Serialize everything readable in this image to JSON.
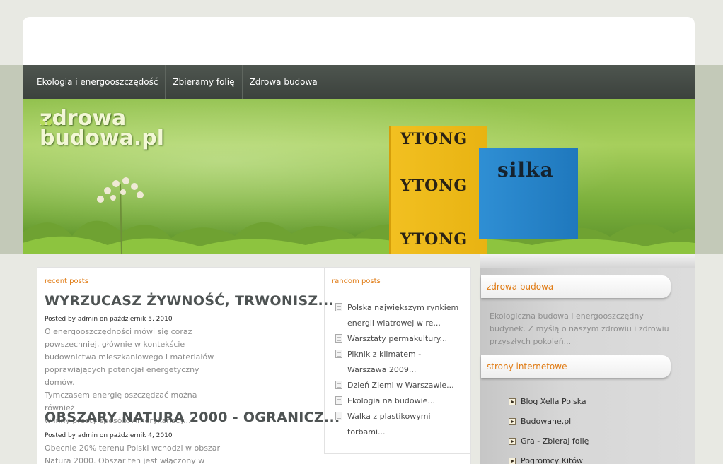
{
  "nav": {
    "items": [
      {
        "label": "Ekologia i energooszczędość"
      },
      {
        "label": "Zbieramy folię"
      },
      {
        "label": "Zdrowa budowa"
      }
    ]
  },
  "banner": {
    "logo_line1": "zdrowa",
    "logo_line2": "budowa.pl",
    "product1": "YTONG",
    "product2": "silka"
  },
  "recent": {
    "label": "recent posts",
    "posts": [
      {
        "title": "WYRZUCASZ ŻYWNOŚĆ, TRWONISZ...",
        "meta": "Posted by admin on październik 5, 2010",
        "body": [
          "O energooszczędności mówi się coraz",
          "powszechniej, głównie w kontekście",
          "budownictwa mieszkaniowego i materiałów",
          "poprawiających potencjał energetyczny domów.",
          "Tymczasem energię oszczędzać można również",
          "w inny prosty sposób. Amerykańscy..."
        ]
      },
      {
        "title": "OBSZARY NATURA 2000 - OGRANICZ...",
        "meta": "Posted by admin on październik 4, 2010",
        "body": [
          "Obecnie 20% terenu Polski wchodzi w obszar",
          "Natura 2000. Obszar ten jest włączony w"
        ]
      }
    ]
  },
  "random": {
    "label": "random posts",
    "items": [
      {
        "line1": "Polska największym rynkiem",
        "line2": "energii wiatrowej w re..."
      },
      {
        "line1": "Warsztaty permakultury...",
        "line2": ""
      },
      {
        "line1": "Piknik z klimatem -",
        "line2": "Warszawa 2009..."
      },
      {
        "line1": "Dzień Ziemi w Warszawie...",
        "line2": ""
      },
      {
        "line1": "Ekologia na budowie...",
        "line2": ""
      },
      {
        "line1": "Walka z plastikowymi",
        "line2": "torbami..."
      }
    ]
  },
  "sidebar": {
    "box1_title": "zdrowa budowa",
    "box1_text": "Ekologiczna budowa i energooszczędny budynek. Z myślą o naszym zdrowiu i zdrowiu przyszłych pokoleń...",
    "box2_title": "strony internetowe",
    "links": [
      {
        "label": "Blog Xella Polska"
      },
      {
        "label": "Budowane.pl"
      },
      {
        "label": "Gra - Zbieraj folię"
      },
      {
        "label": "Pogromcy Kitów"
      }
    ]
  },
  "colors": {
    "accent": "#e07b14",
    "nav_bg": "#444b45",
    "title_gray": "#4e5353"
  }
}
